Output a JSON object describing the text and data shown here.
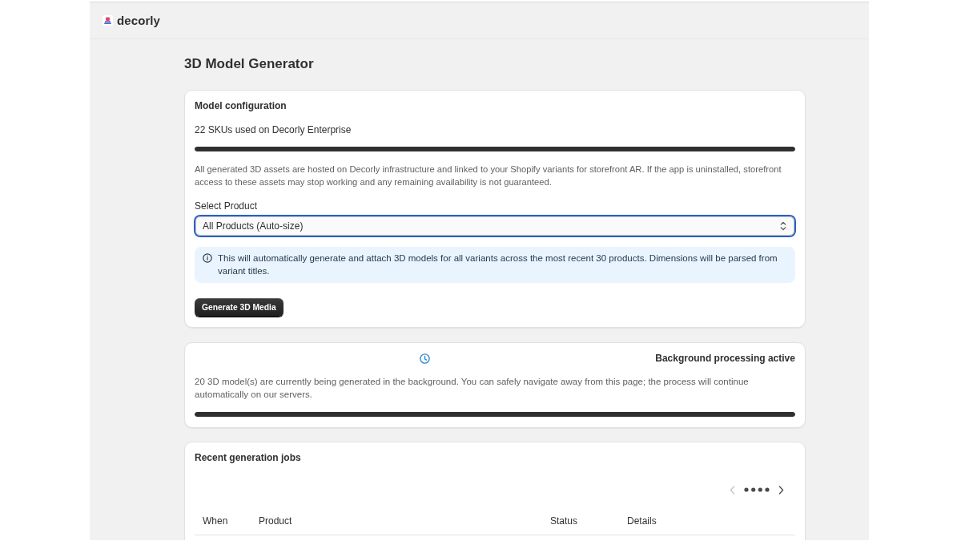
{
  "app": {
    "name": "decorly"
  },
  "page": {
    "title": "3D Model Generator"
  },
  "model_configuration": {
    "title": "Model configuration",
    "usage": "22 SKUs used on Decorly Enterprise",
    "usage_bar": {
      "level": 1
    },
    "notice": "All generated 3D assets are hosted on Decorly infrastructure and linked to your Shopify variants for storefront AR. If the app is uninstalled, storefront access to these assets may stop working and any remaining availability is not guaranteed.",
    "select": {
      "label": "Select Product",
      "value": "All Products (Auto-size)",
      "focused": true
    },
    "info_banner": "This will automatically generate and attach 3D models for all variants across the most recent 30 products. Dimensions will be parsed from variant titles.",
    "button": "Generate 3D Media"
  },
  "background_processing": {
    "status": "Background processing active",
    "message": "20 3D model(s) are currently being generated in the background. You can safely navigate away from this page; the process will continue automatically on our servers.",
    "progress": {
      "level": 1
    }
  },
  "recent_jobs": {
    "title": "Recent generation jobs",
    "pagination": {
      "previous": {
        "disabled": true
      },
      "next": {
        "disabled": false
      }
    },
    "table": {
      "columns": [
        "When",
        "Product",
        "Status",
        "Details"
      ]
    }
  }
}
